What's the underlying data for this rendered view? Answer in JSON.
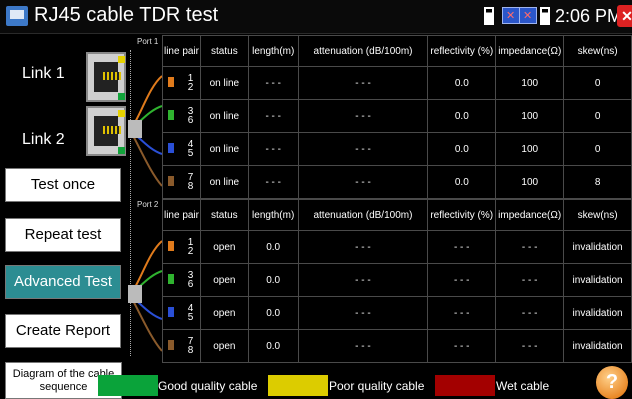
{
  "app": {
    "title": "RJ45 cable TDR test",
    "clock": "2:06 PM"
  },
  "left": {
    "link1": "Link 1",
    "link2": "Link 2",
    "port1": "Port 1",
    "port2": "Port 2",
    "buttons": [
      "Test once",
      "Repeat test",
      "Advanced Test",
      "Create Report"
    ],
    "diagram": "Diagram of the cable sequence"
  },
  "table": {
    "headers": [
      "line pair",
      "status",
      "length(m)",
      "attenuation (dB/100m)",
      "reflectivity (%)",
      "impedance(Ω)",
      "skew(ns)"
    ],
    "port1_rows": [
      {
        "pair_a": "1",
        "pair_b": "2",
        "status": "on line",
        "length": "- - -",
        "attenuation": "- - -",
        "reflectivity": "0.0",
        "impedance": "100",
        "skew": "0"
      },
      {
        "pair_a": "3",
        "pair_b": "6",
        "status": "on line",
        "length": "- - -",
        "attenuation": "- - -",
        "reflectivity": "0.0",
        "impedance": "100",
        "skew": "0"
      },
      {
        "pair_a": "4",
        "pair_b": "5",
        "status": "on line",
        "length": "- - -",
        "attenuation": "- - -",
        "reflectivity": "0.0",
        "impedance": "100",
        "skew": "0"
      },
      {
        "pair_a": "7",
        "pair_b": "8",
        "status": "on line",
        "length": "- - -",
        "attenuation": "- - -",
        "reflectivity": "0.0",
        "impedance": "100",
        "skew": "8"
      }
    ],
    "port2_rows": [
      {
        "pair_a": "1",
        "pair_b": "2",
        "status": "open",
        "length": "0.0",
        "attenuation": "- - -",
        "reflectivity": "- - -",
        "impedance": "- - -",
        "skew": "invalidation"
      },
      {
        "pair_a": "3",
        "pair_b": "6",
        "status": "open",
        "length": "0.0",
        "attenuation": "- - -",
        "reflectivity": "- - -",
        "impedance": "- - -",
        "skew": "invalidation"
      },
      {
        "pair_a": "4",
        "pair_b": "5",
        "status": "open",
        "length": "0.0",
        "attenuation": "- - -",
        "reflectivity": "- - -",
        "impedance": "- - -",
        "skew": "invalidation"
      },
      {
        "pair_a": "7",
        "pair_b": "8",
        "status": "open",
        "length": "0.0",
        "attenuation": "- - -",
        "reflectivity": "- - -",
        "impedance": "- - -",
        "skew": "invalidation"
      }
    ]
  },
  "legend": {
    "good": "Good quality cable",
    "poor": "Poor quality cable",
    "wet": "Wet cable",
    "good_color": "#0aa33a",
    "poor_color": "#dccc00",
    "wet_color": "#a30000"
  },
  "pair_colors": [
    "#e07b1c",
    "#2fb32f",
    "#2a4fd6",
    "#8a5a2b"
  ],
  "icons": {
    "app": "app-window-icon",
    "battery": "battery-icon",
    "network": "network-disconnected-icon",
    "close": "close-icon",
    "help": "help-icon"
  },
  "help_glyph": "?",
  "close_glyph": "✕"
}
